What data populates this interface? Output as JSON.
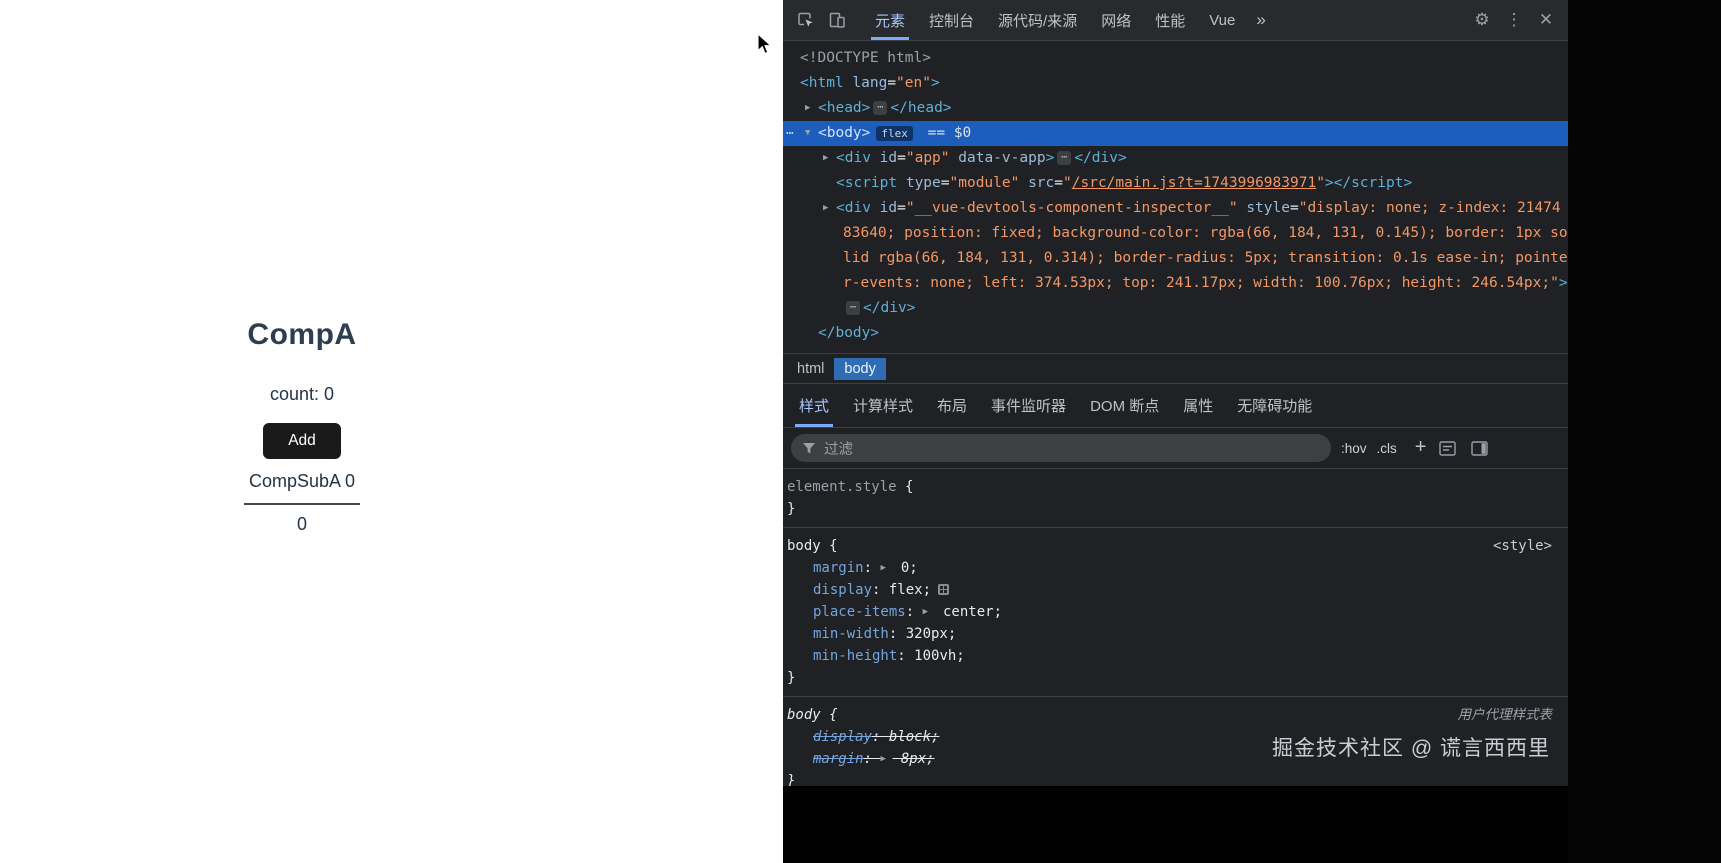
{
  "page": {
    "title": "CompA",
    "count_text": "count: 0",
    "add_button": "Add",
    "comp_sub_text": "CompSubA 0",
    "sub_value": "0"
  },
  "devtools": {
    "toolbar": {
      "tabs": [
        "元素",
        "控制台",
        "源代码/来源",
        "网络",
        "性能",
        "Vue"
      ],
      "more_tabs": "»",
      "settings_icon": "⚙",
      "menu_icon": "⋮",
      "close_icon": "✕"
    },
    "elements_tree": {
      "lines": [
        {
          "ind": 0,
          "tokens": [
            {
              "k": "gray",
              "t": "<!DOCTYPE html>"
            }
          ]
        },
        {
          "ind": 0,
          "tokens": [
            {
              "k": "tag",
              "t": "<html "
            },
            {
              "k": "attr",
              "t": "lang"
            },
            {
              "k": "plain",
              "t": "="
            },
            {
              "k": "val",
              "t": "\"en\""
            },
            {
              "k": "tag",
              "t": ">"
            }
          ]
        },
        {
          "ind": 1,
          "tokens": [
            {
              "k": "arrow",
              "t": "▶"
            },
            {
              "k": "tag",
              "t": "<head>"
            },
            {
              "k": "ellipsis",
              "t": "⋯"
            },
            {
              "k": "tag",
              "t": "</head>"
            }
          ]
        },
        {
          "ind": 1,
          "selected": true,
          "tokens": [
            {
              "k": "gutter",
              "t": "⋯"
            },
            {
              "k": "arrow",
              "t": "▼"
            },
            {
              "k": "tag",
              "t": "<body>"
            },
            {
              "k": "badge",
              "t": "flex"
            },
            {
              "k": "eq",
              "t": " == "
            },
            {
              "k": "eq",
              "t": "$0"
            }
          ]
        },
        {
          "ind": 2,
          "tokens": [
            {
              "k": "arrow",
              "t": "▶"
            },
            {
              "k": "tag",
              "t": "<div "
            },
            {
              "k": "attr",
              "t": "id"
            },
            {
              "k": "plain",
              "t": "="
            },
            {
              "k": "val",
              "t": "\"app\""
            },
            {
              "k": "plain",
              "t": " "
            },
            {
              "k": "attr",
              "t": "data-v-app"
            },
            {
              "k": "tag",
              "t": ">"
            },
            {
              "k": "ellipsis",
              "t": "⋯"
            },
            {
              "k": "tag",
              "t": "</div>"
            }
          ]
        },
        {
          "ind": 2,
          "tokens": [
            {
              "k": "tag",
              "t": "<script "
            },
            {
              "k": "attr",
              "t": "type"
            },
            {
              "k": "plain",
              "t": "="
            },
            {
              "k": "val",
              "t": "\"module\""
            },
            {
              "k": "plain",
              "t": " "
            },
            {
              "k": "attr",
              "t": "src"
            },
            {
              "k": "plain",
              "t": "="
            },
            {
              "k": "val",
              "t": "\""
            },
            {
              "k": "linkval",
              "t": "/src/main.js?t=1743996983971"
            },
            {
              "k": "val",
              "t": "\""
            },
            {
              "k": "tag",
              "t": "></script>"
            }
          ]
        },
        {
          "ind": 2,
          "wrap": true,
          "tokens": [
            {
              "k": "arrow",
              "t": "▶"
            },
            {
              "k": "tag",
              "t": "<div "
            },
            {
              "k": "attr",
              "t": "id"
            },
            {
              "k": "plain",
              "t": "="
            },
            {
              "k": "val",
              "t": "\"__vue-devtools-component-inspector__\""
            },
            {
              "k": "plain",
              "t": " "
            },
            {
              "k": "attr",
              "t": "style"
            },
            {
              "k": "plain",
              "t": "="
            },
            {
              "k": "val",
              "t": "\"display: none; z-index: 2147483640; position: fixed; background-color: rgba(66, 184, 131, 0.145); border: 1px solid rgba(66, 184, 131, 0.314); border-radius: 5px; transition: 0.1s ease-in; pointer-events: none; left: 374.53px; top: 241.17px; width: 100.76px; height: 246.54px;\""
            },
            {
              "k": "tag",
              "t": ">"
            },
            {
              "k": "ellipsis",
              "t": "⋯"
            },
            {
              "k": "tag",
              "t": "</div>"
            }
          ]
        },
        {
          "ind": 1,
          "tokens": [
            {
              "k": "tag",
              "t": "</body>"
            }
          ]
        }
      ]
    },
    "breadcrumbs": {
      "items": [
        "html",
        "body"
      ]
    },
    "styles_tabs": [
      "样式",
      "计算样式",
      "布局",
      "事件监听器",
      "DOM 断点",
      "属性",
      "无障碍功能"
    ],
    "filter": {
      "placeholder": "过滤",
      "hov": ":hov",
      "cls": ".cls",
      "plus": "+"
    },
    "styles_pane": {
      "element_style": {
        "lines": [
          {
            "ind": 0,
            "tokens": [
              {
                "k": "gray",
                "t": "element.style"
              },
              {
                "k": "plain",
                "t": " {"
              }
            ]
          },
          {
            "ind": 0,
            "tokens": [
              {
                "k": "plain",
                "t": "}"
              }
            ]
          }
        ]
      },
      "rule_body": {
        "lines": [
          {
            "ind": 0,
            "right": {
              "k": "origin",
              "t": "<style>"
            },
            "tokens": [
              {
                "k": "sel",
                "t": "body"
              },
              {
                "k": "plain",
                "t": " {"
              }
            ]
          },
          {
            "ind": 1,
            "tokens": [
              {
                "k": "prop",
                "t": "margin"
              },
              {
                "k": "plain",
                "t": ": "
              },
              {
                "k": "arrow",
                "t": "▶"
              },
              {
                "k": "pval",
                "t": " 0;"
              }
            ]
          },
          {
            "ind": 1,
            "tokens": [
              {
                "k": "prop",
                "t": "display"
              },
              {
                "k": "plain",
                "t": ": "
              },
              {
                "k": "pval",
                "t": "flex;"
              },
              {
                "k": "flexicon",
                "t": ""
              }
            ]
          },
          {
            "ind": 1,
            "tokens": [
              {
                "k": "prop",
                "t": "place-items"
              },
              {
                "k": "plain",
                "t": ": "
              },
              {
                "k": "arrow",
                "t": "▶"
              },
              {
                "k": "pval",
                "t": " center;"
              }
            ]
          },
          {
            "ind": 1,
            "tokens": [
              {
                "k": "prop",
                "t": "min-width"
              },
              {
                "k": "plain",
                "t": ": "
              },
              {
                "k": "pval",
                "t": "320px;"
              }
            ]
          },
          {
            "ind": 1,
            "tokens": [
              {
                "k": "prop",
                "t": "min-height"
              },
              {
                "k": "plain",
                "t": ": "
              },
              {
                "k": "pval",
                "t": "100vh;"
              }
            ]
          },
          {
            "ind": 0,
            "tokens": [
              {
                "k": "plain",
                "t": "}"
              }
            ]
          }
        ]
      },
      "rule_body_ua": {
        "lines": [
          {
            "ind": 0,
            "italic": true,
            "right": {
              "k": "ua",
              "t": "用户代理样式表"
            },
            "tokens": [
              {
                "k": "sel",
                "t": "body"
              },
              {
                "k": "plain",
                "t": " {"
              }
            ]
          },
          {
            "ind": 1,
            "struck": true,
            "italic": true,
            "tokens": [
              {
                "k": "prop",
                "t": "display"
              },
              {
                "k": "plain",
                "t": ": "
              },
              {
                "k": "pval",
                "t": "block;"
              }
            ]
          },
          {
            "ind": 1,
            "struck": true,
            "italic": true,
            "tokens": [
              {
                "k": "prop",
                "t": "margin"
              },
              {
                "k": "plain",
                "t": ": "
              },
              {
                "k": "arrow",
                "t": "▶"
              },
              {
                "k": "pval",
                "t": " 8px;"
              }
            ]
          },
          {
            "ind": 0,
            "italic": true,
            "tokens": [
              {
                "k": "plain",
                "t": "}"
              }
            ]
          }
        ]
      }
    },
    "watermark": "掘金技术社区 @ 谎言西西里"
  }
}
